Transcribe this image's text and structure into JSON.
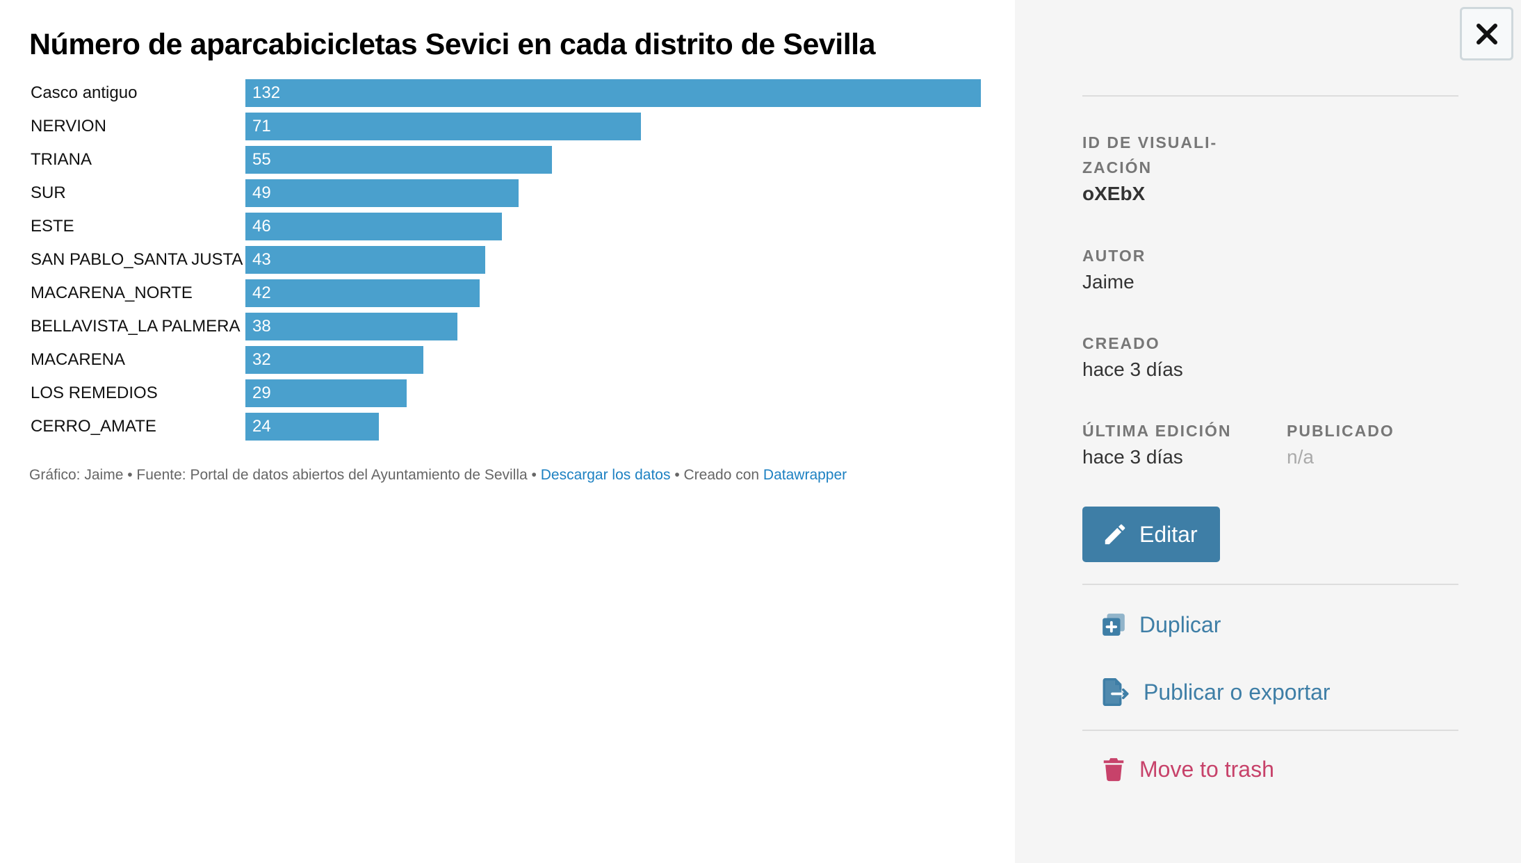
{
  "chart_data": {
    "type": "bar",
    "title": "Número de aparcabicicletas Sevici en cada distrito de Sevilla",
    "categories": [
      "Casco antiguo",
      "NERVION",
      "TRIANA",
      "SUR",
      "ESTE",
      "SAN PABLO_SANTA JUSTA",
      "MACARENA_NORTE",
      "BELLAVISTA_LA PALMERA",
      "MACARENA",
      "LOS REMEDIOS",
      "CERRO_AMATE"
    ],
    "values": [
      132,
      71,
      55,
      49,
      46,
      43,
      42,
      38,
      32,
      29,
      24
    ],
    "value_labels": [
      "132",
      "71",
      "55",
      "49",
      "46",
      "43",
      "42",
      "38",
      "32",
      "29",
      "24"
    ],
    "xlim": [
      0,
      132
    ],
    "orientation": "horizontal",
    "grid": false,
    "legend": "none",
    "bar_color": "#4aa0cd"
  },
  "footer": {
    "byline": "Gráfico: Jaime • Fuente: Portal de datos abiertos del Ayuntamiento de Sevilla • ",
    "download_link": "Descargar los datos",
    "created_with": " • Creado con ",
    "tool_link": "Datawrapper"
  },
  "sidebar": {
    "close_icon": "close-icon",
    "id_label_line1": "ID DE VISUALI-",
    "id_label_line2": "ZACIÓN",
    "id_value": "oXEbX",
    "author_label": "AUTOR",
    "author_value": "Jaime",
    "created_label": "CREADO",
    "created_value": "hace 3 días",
    "last_edit_label": "ÚLTIMA EDICIÓN",
    "last_edit_value": "hace 3 días",
    "published_label": "PUBLICADO",
    "published_value": "n/a",
    "edit_label": "Editar",
    "duplicate_label": "Duplicar",
    "publish_label": "Publicar o exportar",
    "trash_label": "Move to trash"
  },
  "colors": {
    "accent": "#3e7ea6",
    "danger": "#c7426a",
    "bar": "#4aa0cd",
    "link": "#1d81c2"
  }
}
